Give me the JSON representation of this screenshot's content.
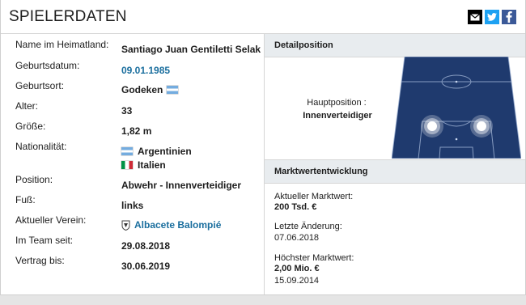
{
  "header": {
    "title": "SPIELERDATEN"
  },
  "share": {
    "icons": [
      "envelope-icon",
      "twitter-icon",
      "facebook-icon"
    ],
    "email_color": "#000000",
    "twitter_color": "#1da1f2",
    "facebook_color": "#3b5998"
  },
  "details": {
    "name_label": "Name im Heimatland:",
    "name_value": "Santiago Juan Gentiletti Selak",
    "birth_label": "Geburtsdatum:",
    "birth_value": "09.01.1985",
    "birthplace_label": "Geburtsort:",
    "birthplace_value": "Godeken",
    "age_label": "Alter:",
    "age_value": "33",
    "height_label": "Größe:",
    "height_value": "1,82 m",
    "nationality_label": "Nationalität:",
    "nationality_1": "Argentinien",
    "nationality_2": "Italien",
    "position_label": "Position:",
    "position_value": "Abwehr - Innenverteidiger",
    "foot_label": "Fuß:",
    "foot_value": "links",
    "club_label": "Aktueller Verein:",
    "club_value": "Albacete Balompié",
    "team_since_label": "Im Team seit:",
    "team_since_value": "29.08.2018",
    "contract_label": "Vertrag bis:",
    "contract_value": "30.06.2019"
  },
  "position_box": {
    "title": "Detailposition",
    "main_label": "Hauptposition :",
    "main_value": "Innenverteidiger",
    "pitch_color": "#1f3a6e"
  },
  "market": {
    "title": "Marktwertentwicklung",
    "current_label": "Aktueller Marktwert:",
    "current_value": "200 Tsd. €",
    "last_change_label": "Letzte Änderung:",
    "last_change_value": "07.06.2018",
    "highest_label": "Höchster Marktwert:",
    "highest_value": "2,00 Mio. €",
    "highest_date": "15.09.2014"
  },
  "colors": {
    "link": "#1a6e9e",
    "section_header": "#e8ecef"
  }
}
